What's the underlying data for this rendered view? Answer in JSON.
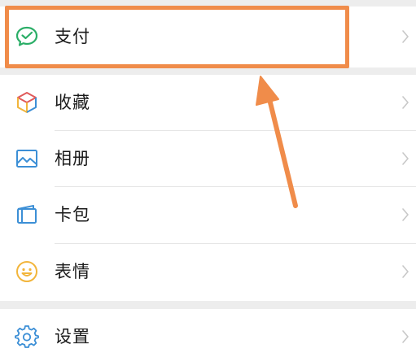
{
  "menu": {
    "pay": {
      "label": "支付",
      "icon": "wechat-pay-icon"
    },
    "items": [
      {
        "label": "收藏",
        "icon": "favorites-cube-icon"
      },
      {
        "label": "相册",
        "icon": "album-picture-icon"
      },
      {
        "label": "卡包",
        "icon": "card-wallet-icon"
      },
      {
        "label": "表情",
        "icon": "smiley-face-icon"
      }
    ],
    "settings": {
      "label": "设置",
      "icon": "gear-icon"
    }
  },
  "annotation": {
    "highlight_color": "#f08c4a",
    "arrow_color": "#f08c4a"
  },
  "colors": {
    "pay_green": "#2aae67",
    "background": "#ededed",
    "chevron": "#c8c8c8"
  }
}
